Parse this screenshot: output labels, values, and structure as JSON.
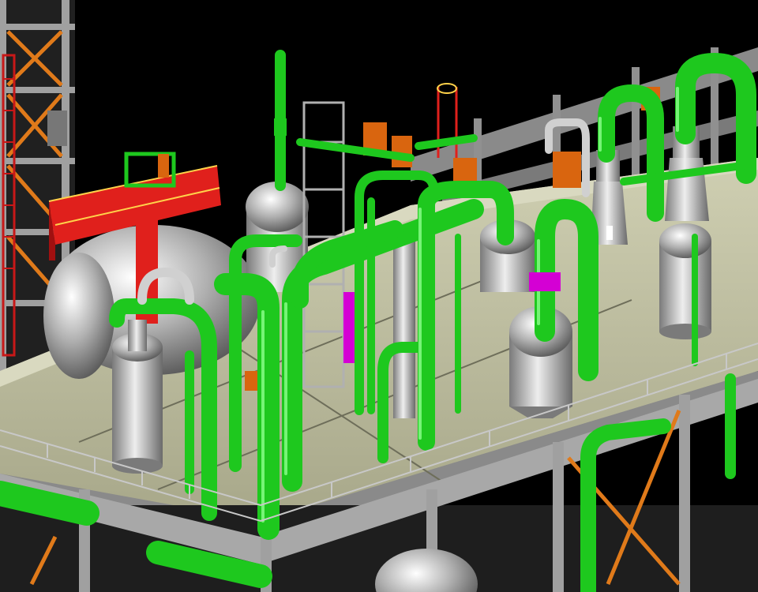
{
  "scene": {
    "kind": "3d-plant-piping-model",
    "colors": {
      "background": "#000000",
      "pipe": "#1ec81e",
      "pipe_highlight": "#8cff8c",
      "vessel": "#b4b4b4",
      "vessel_shadow": "#6e6e6e",
      "steel": "#9a9a9a",
      "floor": "#b8b89a",
      "bracing": "#e07a1a",
      "equipment_box": "#d9650f",
      "tank_frame": "#e0201c",
      "ladder": "#c81818",
      "flange": "#d400d4"
    }
  }
}
